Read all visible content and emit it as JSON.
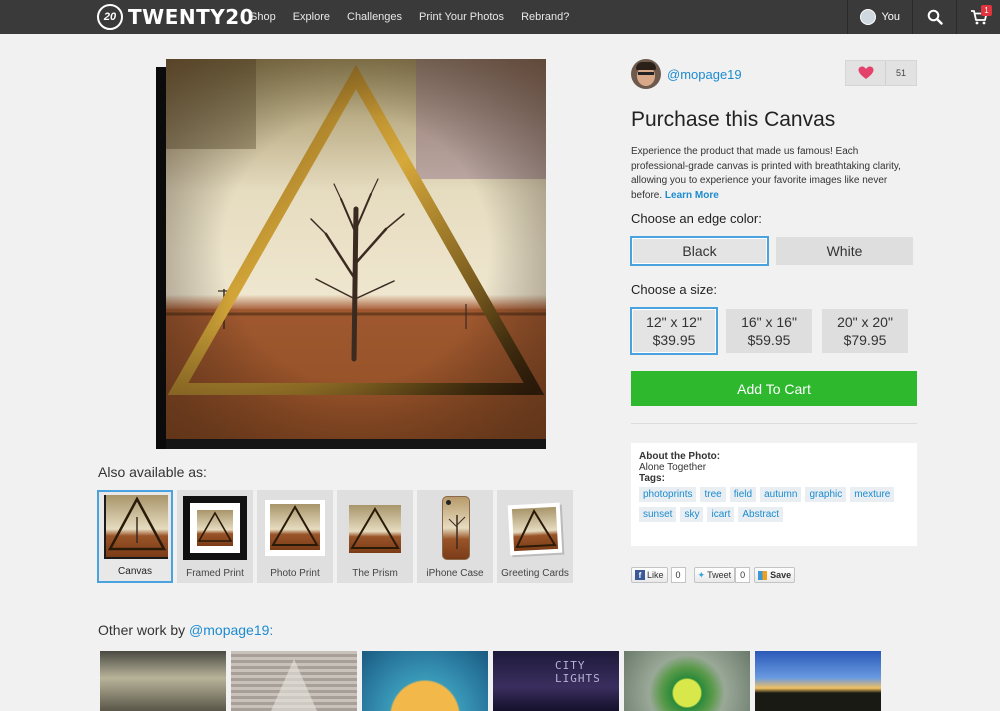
{
  "nav": {
    "logo_badge": "20",
    "logo_text": "TWENTY20",
    "links": [
      "Shop",
      "Explore",
      "Challenges",
      "Print Your Photos",
      "Rebrand?"
    ],
    "you_label": "You",
    "cart_count": "1"
  },
  "formats": {
    "label": "Also available as:",
    "items": [
      "Canvas",
      "Framed Print",
      "Photo Print",
      "The Prism",
      "iPhone Case",
      "Greeting Cards"
    ],
    "selected": "Canvas"
  },
  "other_work": {
    "label": "Other work by ",
    "user": "@mopage19:"
  },
  "user": {
    "handle": "@mopage19",
    "likes": "51"
  },
  "purchase": {
    "title": "Purchase this Canvas",
    "description": "Experience the product that made us famous! Each professional-grade canvas is printed with breathtaking clarity, allowing you to experience your favorite images like never before.",
    "learn_more": "Learn More",
    "edge_label": "Choose an edge color:",
    "edge_options": [
      "Black",
      "White"
    ],
    "edge_selected": "Black",
    "size_label": "Choose a size:",
    "sizes": [
      {
        "size": "12\" x 12\"",
        "price": "$39.95"
      },
      {
        "size": "16\" x 16\"",
        "price": "$59.95"
      },
      {
        "size": "20\" x 20\"",
        "price": "$79.95"
      }
    ],
    "size_selected": "12\" x 12\"",
    "add_to_cart": "Add To Cart"
  },
  "about": {
    "heading": "About the Photo:",
    "title": "Alone Together",
    "tags_label": "Tags:",
    "tags": [
      "photoprints",
      "tree",
      "field",
      "autumn",
      "graphic",
      "mexture",
      "sunset",
      "sky",
      "icart",
      "Abstract"
    ]
  },
  "social": {
    "like_label": "Like",
    "like_count": "0",
    "tweet_label": "Tweet",
    "tweet_count": "0",
    "save_label": "Save"
  },
  "colors": {
    "accent": "#1c8bd0",
    "select_border": "#4aa3df",
    "cart_green": "#2eb82e",
    "nav_bg": "#3a3a3a",
    "heart": "#e3426a"
  }
}
